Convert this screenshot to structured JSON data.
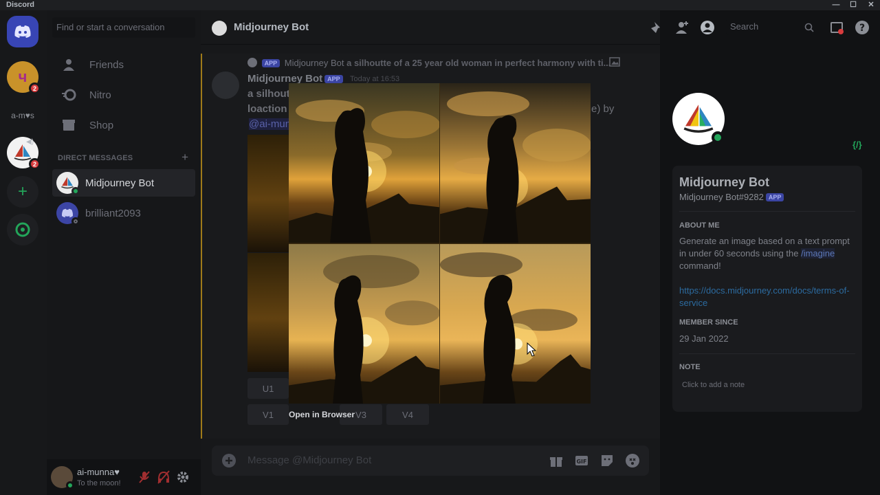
{
  "window": {
    "title": "Discord",
    "controls": [
      "—",
      "☐",
      "✕"
    ]
  },
  "servers": {
    "items": [
      {
        "name": "home",
        "label": ""
      },
      {
        "name": "server-u",
        "label": "ч",
        "badge": "2"
      },
      {
        "name": "server-a-m",
        "label": "a-m♥s"
      },
      {
        "name": "server-midjourney",
        "label": "",
        "badge": "2"
      },
      {
        "name": "add-server",
        "label": "+"
      },
      {
        "name": "explore",
        "label": ""
      }
    ]
  },
  "dm": {
    "search_placeholder": "Find or start a conversation",
    "nav": [
      {
        "label": "Friends"
      },
      {
        "label": "Nitro"
      },
      {
        "label": "Shop"
      }
    ],
    "header": "DIRECT MESSAGES",
    "items": [
      {
        "label": "Midjourney Bot"
      },
      {
        "label": "brilliant2093"
      }
    ]
  },
  "user": {
    "name": "ai-munna♥",
    "status": "To the moon!"
  },
  "chat": {
    "title": "Midjourney Bot",
    "search_placeholder": "Search",
    "reply_author": "Midjourney Bot",
    "reply_text": "a silhoutte of a 25 year old woman in perfect harmony with ti...",
    "app_tag": "APP",
    "author": "Midjourney Bot",
    "time": "Today at 16:53",
    "line1": "a silhoutt",
    "line2": "loaction",
    "line2_tail": "e) by",
    "mention": "@ai-mun",
    "buttons": [
      "U1",
      "V1",
      "V3",
      "V4"
    ],
    "composer_placeholder": "Message @Midjourney Bot"
  },
  "overlay": {
    "open_in_browser": "Open in Browser"
  },
  "profile": {
    "name": "Midjourney Bot",
    "tag": "Midjourney Bot#9282",
    "app_tag": "APP",
    "about_header": "ABOUT ME",
    "about_text_a": "Generate an image based on a text prompt in under 60 seconds using the ",
    "about_cmd": "/imagine",
    "about_text_b": " command!",
    "link": "https://docs.midjourney.com/docs/terms-of-service",
    "since_header": "MEMBER SINCE",
    "since": "29 Jan 2022",
    "note_header": "NOTE",
    "note_placeholder": "Click to add a note"
  },
  "colors": {
    "accent": "#5865f2",
    "online": "#23a55a",
    "danger": "#d83c3e",
    "mention_bar": "#a07b19"
  }
}
